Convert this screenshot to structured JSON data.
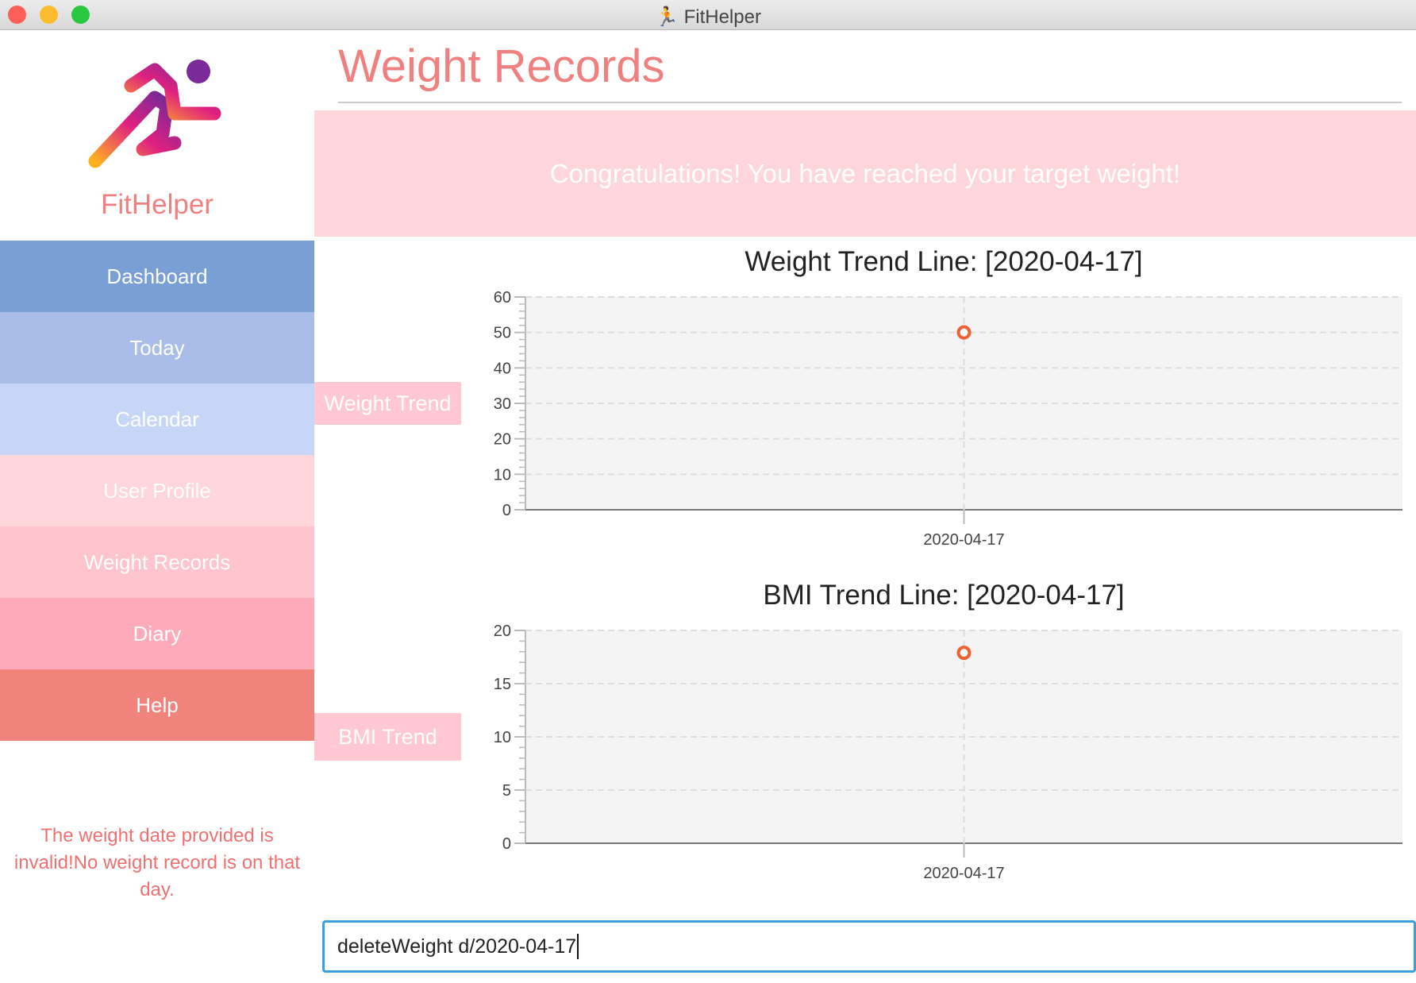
{
  "window": {
    "title": "FitHelper"
  },
  "sidebar": {
    "brand": "FitHelper",
    "items": [
      {
        "label": "Dashboard",
        "color": "#7a9fd4"
      },
      {
        "label": "Today",
        "color": "#aabde9"
      },
      {
        "label": "Calendar",
        "color": "#c7d5f7"
      },
      {
        "label": "User Profile",
        "color": "#ffd6dc"
      },
      {
        "label": "Weight Records",
        "color": "#ffc4ce"
      },
      {
        "label": "Diary",
        "color": "#ffaab8"
      },
      {
        "label": "Help",
        "color": "#f0837c"
      }
    ],
    "result_message": "The weight date provided is invalid!No weight record is on that day."
  },
  "main": {
    "title": "Weight Records",
    "banner": "Congratulations! You have reached your target weight!",
    "weight_tab": "Weight Trend",
    "bmi_tab": "BMI Trend"
  },
  "command": {
    "value": "deleteWeight d/2020-04-17"
  },
  "chart_data": [
    {
      "type": "line",
      "title": "Weight Trend Line: [2020-04-17]",
      "categories": [
        "2020-04-17"
      ],
      "values": [
        50
      ],
      "ylim": [
        0,
        60
      ],
      "yticks": [
        0,
        10,
        20,
        30,
        40,
        50,
        60
      ],
      "grid": true,
      "marker_color": "#f06030"
    },
    {
      "type": "line",
      "title": "BMI Trend Line: [2020-04-17]",
      "categories": [
        "2020-04-17"
      ],
      "values": [
        17.9
      ],
      "ylim": [
        0,
        20
      ],
      "yticks": [
        0,
        5,
        10,
        15,
        20
      ],
      "grid": true,
      "marker_color": "#f06030"
    }
  ]
}
